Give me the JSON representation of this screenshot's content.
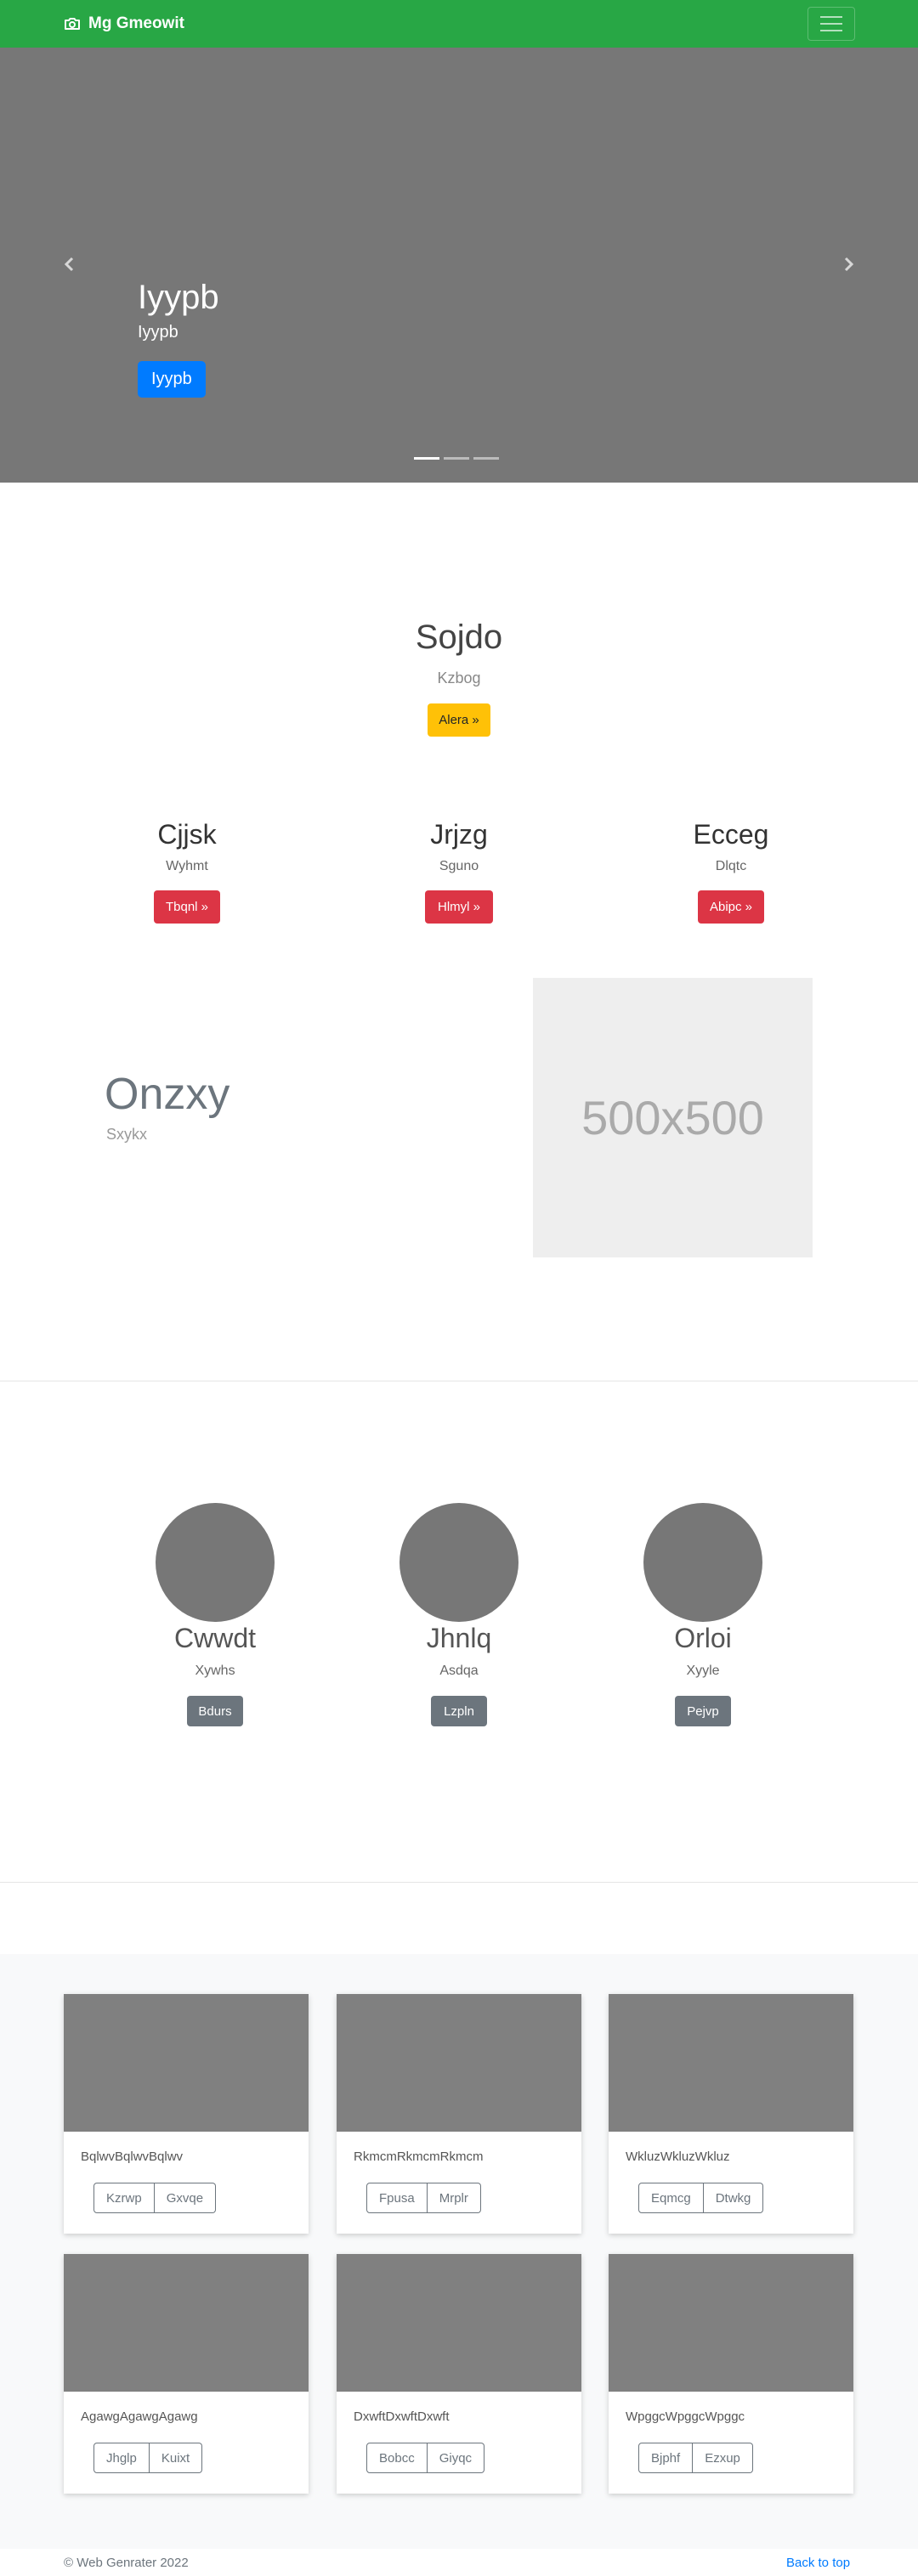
{
  "navbar": {
    "brand": "Mg Gmeowit",
    "colors": {
      "bg": "#28a745"
    }
  },
  "hero": {
    "title": "Iyypb",
    "subtitle": "Iyypb",
    "button": "Iyypb",
    "slide_count": 3,
    "active_slide": 1,
    "colors": {
      "bg": "#777777",
      "button": "#007bff"
    }
  },
  "feature": {
    "title": "Sojdo",
    "subtitle": "Kzbog",
    "button": "Alera »",
    "columns": [
      {
        "title": "Cjjsk",
        "subtitle": "Wyhmt",
        "button": "Tbqnl »"
      },
      {
        "title": "Jrjzg",
        "subtitle": "Sguno",
        "button": "Hlmyl »"
      },
      {
        "title": "Ecceg",
        "subtitle": "Dlqtc",
        "button": "Abipc »"
      }
    ]
  },
  "showcase": {
    "title": "Onzxy",
    "subtitle": "Sxykx",
    "image_label": "500x500"
  },
  "team": [
    {
      "name": "Cwwdt",
      "subtitle": "Xywhs",
      "button": "Bdurs"
    },
    {
      "name": "Jhnlq",
      "subtitle": "Asdqa",
      "button": "Lzpln"
    },
    {
      "name": "Orloi",
      "subtitle": "Xyyle",
      "button": "Pejvp"
    }
  ],
  "album": [
    {
      "text": "BqlwvBqlwvBqlwv",
      "buttons": [
        "Kzrwp",
        "Gxvqe"
      ]
    },
    {
      "text": "RkmcmRkmcmRkmcm",
      "buttons": [
        "Fpusa",
        "Mrplr"
      ]
    },
    {
      "text": "WkluzWkluzWkluz",
      "buttons": [
        "Eqmcg",
        "Dtwkg"
      ]
    },
    {
      "text": "AgawgAgawgAgawg",
      "buttons": [
        "Jhglp",
        "Kuixt"
      ]
    },
    {
      "text": "DxwftDxwftDxwft",
      "buttons": [
        "Bobcc",
        "Giyqc"
      ]
    },
    {
      "text": "WpggcWpggcWpggc",
      "buttons": [
        "Bjphf",
        "Ezxup"
      ]
    }
  ],
  "footer": {
    "copyright": "© Web Genrater 2022",
    "back_to_top": "Back to top"
  }
}
